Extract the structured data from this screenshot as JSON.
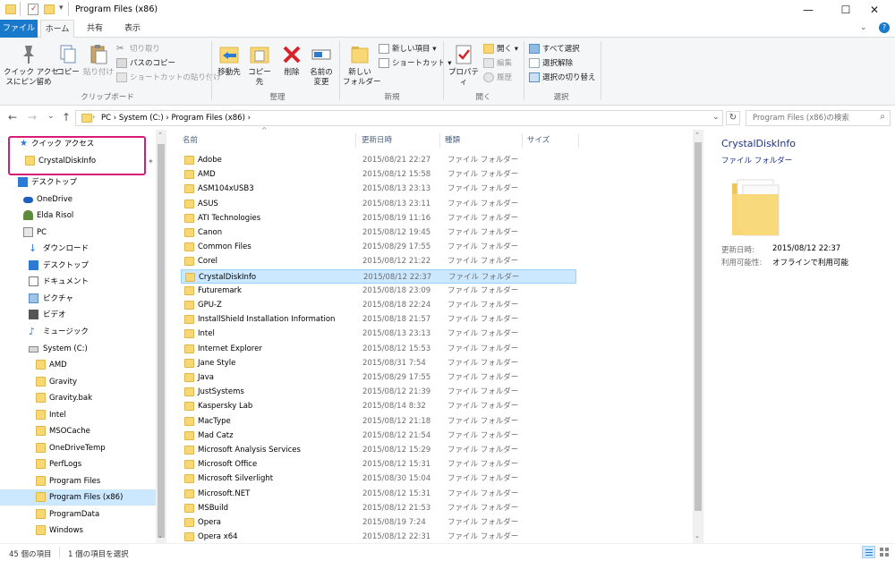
{
  "window": {
    "title": "Program Files (x86)",
    "controls": {
      "minimize": "—",
      "maximize": "☐",
      "close": "✕"
    }
  },
  "ribbon_tabs": [
    "ファイル",
    "ホーム",
    "共有",
    "表示"
  ],
  "ribbon": {
    "clipboard": {
      "pin": "クイック アクセ\nスにピン留め",
      "copy": "コピー",
      "paste": "貼り付け",
      "cut": "切り取り",
      "copy_path": "パスのコピー",
      "paste_shortcut": "ショートカットの貼り付け",
      "label": "クリップボード"
    },
    "organize": {
      "move_to": "移動先",
      "copy_to": "コピー先",
      "delete": "削除",
      "rename": "名前の\n変更",
      "label": "整理"
    },
    "new": {
      "new_folder": "新しい\nフォルダー",
      "new_item": "新しい項目 ▾",
      "shortcut": "ショートカット ▾",
      "label": "新規"
    },
    "open": {
      "properties": "プロパティ",
      "open": "開く ▾",
      "edit": "編集",
      "history": "履歴",
      "label": "開く"
    },
    "select": {
      "select_all": "すべて選択",
      "select_none": "選択解除",
      "invert": "選択の切り替え",
      "label": "選択"
    }
  },
  "address": {
    "crumbs": "PC  ›  System (C:)  ›  Program Files (x86)  ›",
    "search_placeholder": "Program Files (x86)の検索"
  },
  "nav": {
    "quick_access": "クイック アクセス",
    "pinned": "CrystalDiskInfo",
    "items": [
      {
        "label": "デスクトップ",
        "icon": "desktop-icon"
      },
      {
        "label": "OneDrive",
        "icon": "cloud-icon"
      },
      {
        "label": "Elda Risol",
        "icon": "user-icon"
      },
      {
        "label": "PC",
        "icon": "pc-icon"
      },
      {
        "label": "ダウンロード",
        "icon": "download-icon"
      },
      {
        "label": "デスクトップ",
        "icon": "desktop-icon"
      },
      {
        "label": "ドキュメント",
        "icon": "document-icon"
      },
      {
        "label": "ピクチャ",
        "icon": "picture-icon"
      },
      {
        "label": "ビデオ",
        "icon": "video-icon"
      },
      {
        "label": "ミュージック",
        "icon": "music-icon"
      },
      {
        "label": "System (C:)",
        "icon": "drive-icon"
      },
      {
        "label": "AMD",
        "icon": "folder-icon"
      },
      {
        "label": "Gravity",
        "icon": "folder-icon"
      },
      {
        "label": "Gravity.bak",
        "icon": "folder-icon"
      },
      {
        "label": "Intel",
        "icon": "folder-icon"
      },
      {
        "label": "MSOCache",
        "icon": "folder-icon"
      },
      {
        "label": "OneDriveTemp",
        "icon": "folder-icon"
      },
      {
        "label": "PerfLogs",
        "icon": "folder-icon"
      },
      {
        "label": "Program Files",
        "icon": "folder-icon"
      },
      {
        "label": "Program Files (x86)",
        "icon": "folder-icon"
      },
      {
        "label": "ProgramData",
        "icon": "folder-icon"
      },
      {
        "label": "Windows",
        "icon": "folder-icon"
      }
    ]
  },
  "list": {
    "columns": [
      "名前",
      "更新日時",
      "種類",
      "サイズ"
    ],
    "rows": [
      {
        "name": "Adobe",
        "date": "2015/08/21 22:27",
        "type": "ファイル フォルダー"
      },
      {
        "name": "AMD",
        "date": "2015/08/12 15:58",
        "type": "ファイル フォルダー"
      },
      {
        "name": "ASM104xUSB3",
        "date": "2015/08/13 23:13",
        "type": "ファイル フォルダー"
      },
      {
        "name": "ASUS",
        "date": "2015/08/13 23:11",
        "type": "ファイル フォルダー"
      },
      {
        "name": "ATI Technologies",
        "date": "2015/08/19 11:16",
        "type": "ファイル フォルダー"
      },
      {
        "name": "Canon",
        "date": "2015/08/12 19:45",
        "type": "ファイル フォルダー"
      },
      {
        "name": "Common Files",
        "date": "2015/08/29 17:55",
        "type": "ファイル フォルダー"
      },
      {
        "name": "Corel",
        "date": "2015/08/12 21:22",
        "type": "ファイル フォルダー"
      },
      {
        "name": "CrystalDiskInfo",
        "date": "2015/08/12 22:37",
        "type": "ファイル フォルダー"
      },
      {
        "name": "Futuremark",
        "date": "2015/08/18 23:09",
        "type": "ファイル フォルダー"
      },
      {
        "name": "GPU-Z",
        "date": "2015/08/18 22:24",
        "type": "ファイル フォルダー"
      },
      {
        "name": "InstallShield Installation Information",
        "date": "2015/08/18 21:57",
        "type": "ファイル フォルダー"
      },
      {
        "name": "Intel",
        "date": "2015/08/13 23:13",
        "type": "ファイル フォルダー"
      },
      {
        "name": "Internet Explorer",
        "date": "2015/08/12 15:53",
        "type": "ファイル フォルダー"
      },
      {
        "name": "Jane Style",
        "date": "2015/08/31 7:54",
        "type": "ファイル フォルダー"
      },
      {
        "name": "Java",
        "date": "2015/08/29 17:55",
        "type": "ファイル フォルダー"
      },
      {
        "name": "JustSystems",
        "date": "2015/08/12 21:39",
        "type": "ファイル フォルダー"
      },
      {
        "name": "Kaspersky Lab",
        "date": "2015/08/14 8:32",
        "type": "ファイル フォルダー"
      },
      {
        "name": "MacType",
        "date": "2015/08/12 21:18",
        "type": "ファイル フォルダー"
      },
      {
        "name": "Mad Catz",
        "date": "2015/08/12 21:54",
        "type": "ファイル フォルダー"
      },
      {
        "name": "Microsoft Analysis Services",
        "date": "2015/08/12 15:29",
        "type": "ファイル フォルダー"
      },
      {
        "name": "Microsoft Office",
        "date": "2015/08/12 15:31",
        "type": "ファイル フォルダー"
      },
      {
        "name": "Microsoft Silverlight",
        "date": "2015/08/30 15:04",
        "type": "ファイル フォルダー"
      },
      {
        "name": "Microsoft.NET",
        "date": "2015/08/12 15:31",
        "type": "ファイル フォルダー"
      },
      {
        "name": "MSBuild",
        "date": "2015/08/12 21:53",
        "type": "ファイル フォルダー"
      },
      {
        "name": "Opera",
        "date": "2015/08/19 7:24",
        "type": "ファイル フォルダー"
      },
      {
        "name": "Opera x64",
        "date": "2015/08/12 22:31",
        "type": "ファイル フォルダー"
      }
    ]
  },
  "preview": {
    "name": "CrystalDiskInfo",
    "type": "ファイル フォルダー",
    "modified_label": "更新日時:",
    "modified_value": "2015/08/12 22:37",
    "avail_label": "利用可能性:",
    "avail_value": "オフラインで利用可能"
  },
  "status": {
    "count": "45 個の項目",
    "selected": "1 個の項目を選択"
  },
  "colors": {
    "accent": "#1979ca",
    "selection": "#cce8ff",
    "highlight_box": "#d81b77",
    "preview_title": "#1e3287"
  }
}
